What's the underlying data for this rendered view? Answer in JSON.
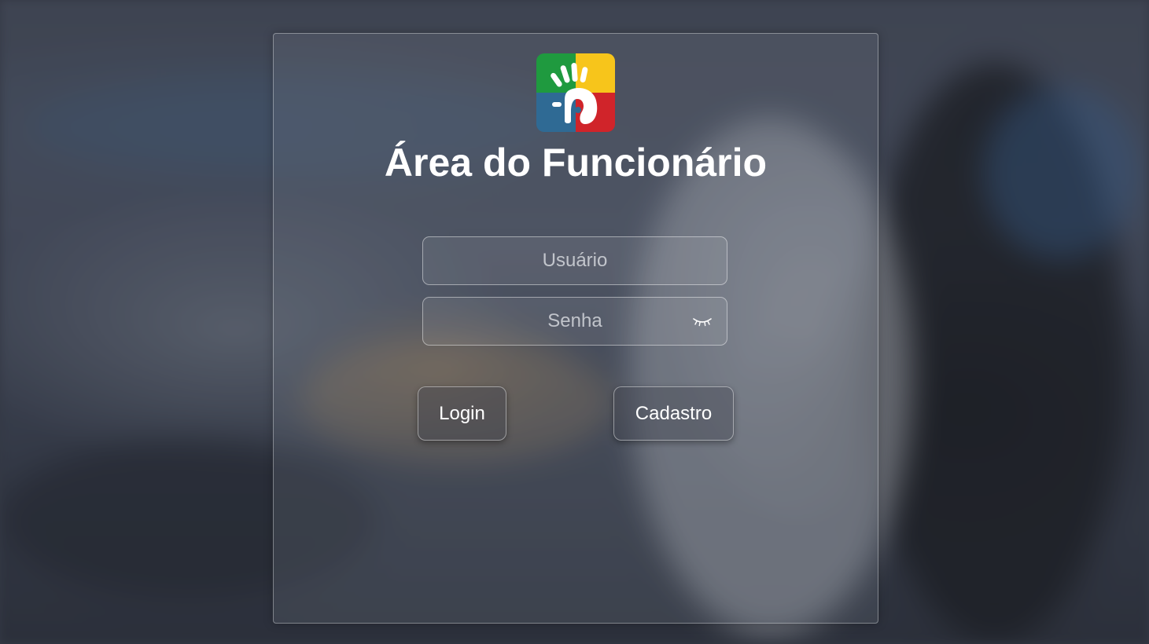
{
  "page": {
    "title": "Área do Funcionário"
  },
  "logo": {
    "name": "company-logo",
    "colors": {
      "green": "#1f9a3f",
      "yellow": "#f7c51b",
      "blue": "#2f6a94",
      "red": "#d0242a"
    }
  },
  "form": {
    "username": {
      "placeholder": "Usuário",
      "value": ""
    },
    "password": {
      "placeholder": "Senha",
      "value": "",
      "toggle_icon": "eye-closed-icon"
    }
  },
  "buttons": {
    "login_label": "Login",
    "register_label": "Cadastro"
  }
}
